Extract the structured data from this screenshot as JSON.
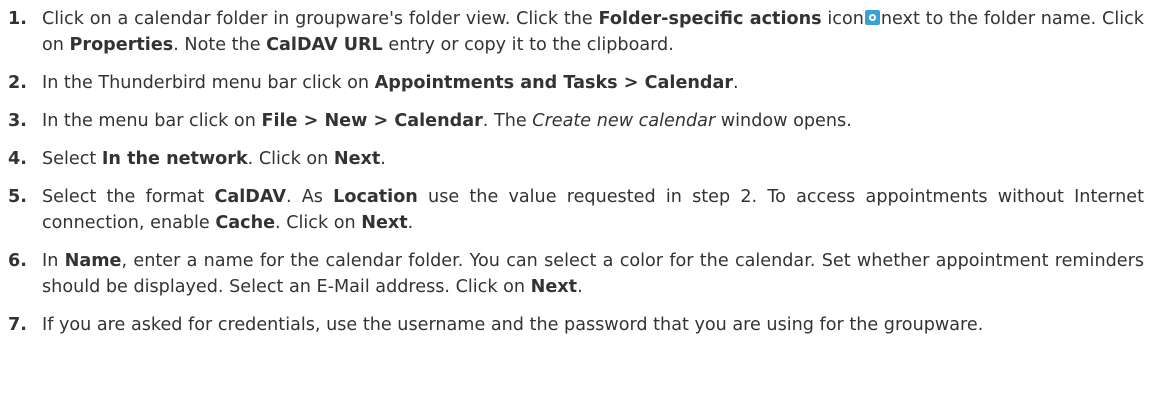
{
  "steps": [
    {
      "num": "1.",
      "t1": "Click on a calendar folder in groupware's folder view. Click the ",
      "b1": "Folder-specific actions",
      "t2": " icon",
      "t3": "next to the folder name. Click on ",
      "b2": "Properties",
      "t4": ". Note the ",
      "b3": "CalDAV URL",
      "t5": " entry or copy it to the clipboard.",
      "icon": "settings-gear-icon"
    },
    {
      "num": "2.",
      "t1": "In the Thunderbird menu bar click on ",
      "b1": "Appointments and Tasks > Calendar",
      "t2": "."
    },
    {
      "num": "3.",
      "t1": "In the menu bar click on ",
      "b1": "File > New > Calendar",
      "t2": ". The ",
      "i1": "Create new calendar",
      "t3": " window opens."
    },
    {
      "num": "4.",
      "t1": "Select ",
      "b1": "In the network",
      "t2": ". Click on ",
      "b2": "Next",
      "t3": "."
    },
    {
      "num": "5.",
      "t1": "Select the format ",
      "b1": "CalDAV",
      "t2": ". As ",
      "b2": "Location",
      "t3": " use the value requested in step 2. To access appointments without Internet connection, enable ",
      "b3": "Cache",
      "t4": ". Click on ",
      "b4": "Next",
      "t5": "."
    },
    {
      "num": "6.",
      "t1": "In ",
      "b1": "Name",
      "t2": ", enter a name for the calendar folder. You can select a color for the calendar. Set whether appointment reminders should be displayed. Select an E-Mail address. Click on ",
      "b2": "Next",
      "t3": "."
    },
    {
      "num": "7.",
      "t1": "If you are asked for credentials, use the username and the password that you are using for the groupware."
    }
  ]
}
